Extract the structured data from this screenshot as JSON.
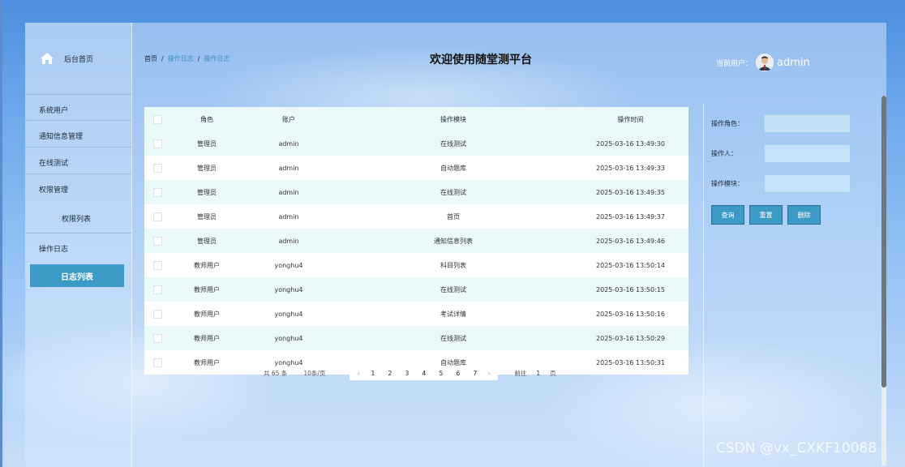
{
  "sidebar": {
    "home_label": "后台首页",
    "items": [
      {
        "label": "系统用户"
      },
      {
        "label": "通知信息管理"
      },
      {
        "label": "在线测试"
      },
      {
        "label": "权限管理"
      },
      {
        "label": "权限列表"
      },
      {
        "label": "操作日志"
      }
    ],
    "active_label": "日志列表"
  },
  "header": {
    "breadcrumb": [
      "首页",
      "操作日志",
      "操作日志"
    ],
    "breadcrumb_sep": "/",
    "title": "欢迎使用随堂测平台",
    "user_label": "当前用户：",
    "user_name": "admin"
  },
  "table": {
    "columns": [
      "角色",
      "账户",
      "操作模块",
      "操作时间"
    ],
    "rows": [
      {
        "role": "管理员",
        "account": "admin",
        "module": "在线测试",
        "time": "2025-03-16 13:49:30"
      },
      {
        "role": "管理员",
        "account": "admin",
        "module": "自动题库",
        "time": "2025-03-16 13:49:33"
      },
      {
        "role": "管理员",
        "account": "admin",
        "module": "在线测试",
        "time": "2025-03-16 13:49:35"
      },
      {
        "role": "管理员",
        "account": "admin",
        "module": "首页",
        "time": "2025-03-16 13:49:37"
      },
      {
        "role": "管理员",
        "account": "admin",
        "module": "通知信息列表",
        "time": "2025-03-16 13:49:46"
      },
      {
        "role": "教师用户",
        "account": "yonghu4",
        "module": "科目列表",
        "time": "2025-03-16 13:50:14"
      },
      {
        "role": "教师用户",
        "account": "yonghu4",
        "module": "在线测试",
        "time": "2025-03-16 13:50:15"
      },
      {
        "role": "教师用户",
        "account": "yonghu4",
        "module": "考试详情",
        "time": "2025-03-16 13:50:16"
      },
      {
        "role": "教师用户",
        "account": "yonghu4",
        "module": "在线测试",
        "time": "2025-03-16 13:50:29"
      },
      {
        "role": "教师用户",
        "account": "yonghu4",
        "module": "自动题库",
        "time": "2025-03-16 13:50:31"
      }
    ]
  },
  "pagination": {
    "total": "共 65 条",
    "page_size": "10条/页",
    "prev": "‹",
    "next": "›",
    "pages": [
      "1",
      "2",
      "3",
      "4",
      "5",
      "6",
      "7"
    ],
    "goto_label": "前往",
    "goto_value": "1",
    "goto_unit": "页"
  },
  "filters": {
    "role_label": "操作角色：",
    "operator_label": "操作人：",
    "module_label": "操作模块：",
    "search_label": "查询",
    "reset_label": "重置",
    "delete_label": "删除"
  },
  "watermark": "CSDN @vx_CXKF10088",
  "colors": {
    "accent": "#3b9bc6",
    "row_tint": "#eafafa"
  }
}
